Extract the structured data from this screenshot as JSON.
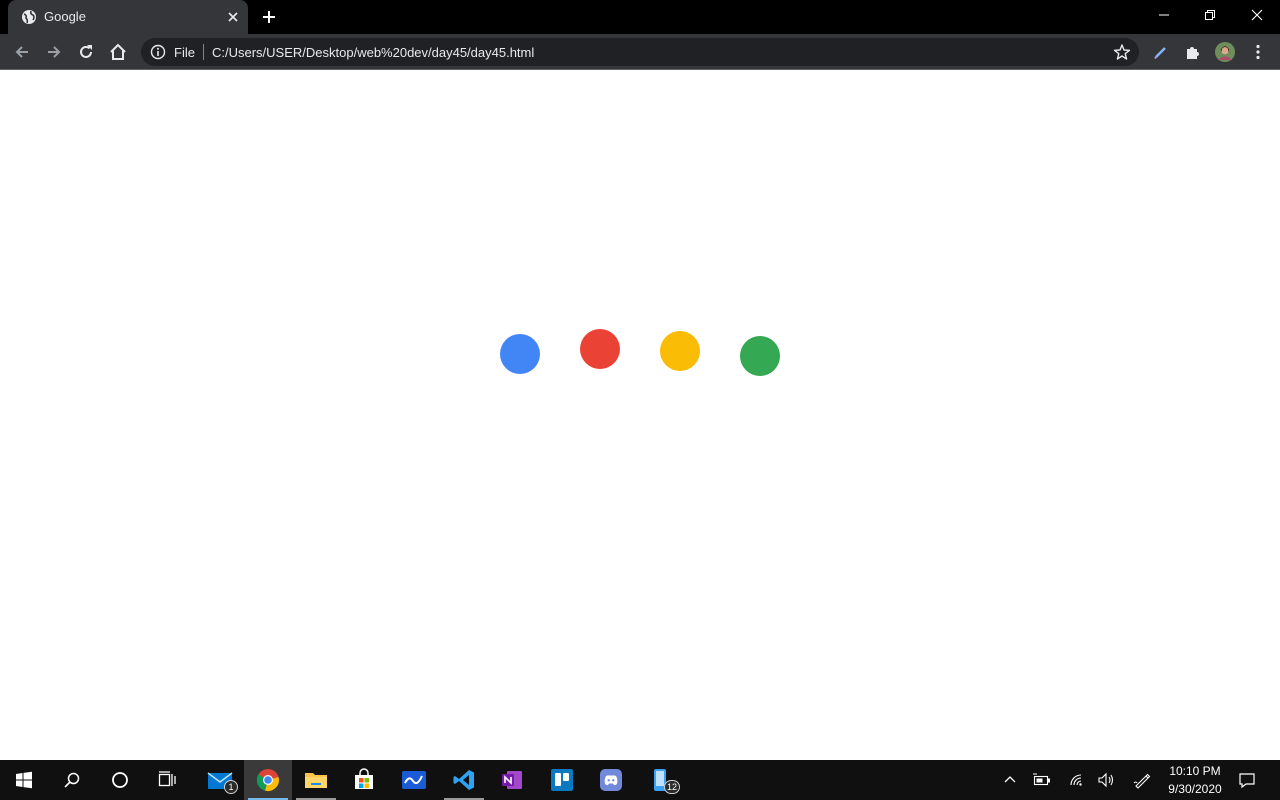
{
  "browser": {
    "tab": {
      "title": "Google",
      "favicon": "globe-icon"
    },
    "omnibox": {
      "scheme_label": "File",
      "url": "C:/Users/USER/Desktop/web%20dev/day45/day45.html"
    },
    "toolbar_icons": [
      "back-icon",
      "forward-icon",
      "reload-icon",
      "home-icon",
      "info-icon",
      "bookmark-star-icon",
      "pen-icon",
      "extensions-icon",
      "profile-avatar",
      "menu-icon"
    ]
  },
  "page": {
    "background": "#ffffff",
    "dots": [
      {
        "name": "blue-dot",
        "color": "#4285f4"
      },
      {
        "name": "red-dot",
        "color": "#ea4335"
      },
      {
        "name": "yellow-dot",
        "color": "#fbbc05"
      },
      {
        "name": "green-dot",
        "color": "#34a853"
      }
    ]
  },
  "taskbar": {
    "mail_badge": "1",
    "phone_badge": "12",
    "clock": {
      "time": "10:10 PM",
      "date": "9/30/2020"
    }
  }
}
